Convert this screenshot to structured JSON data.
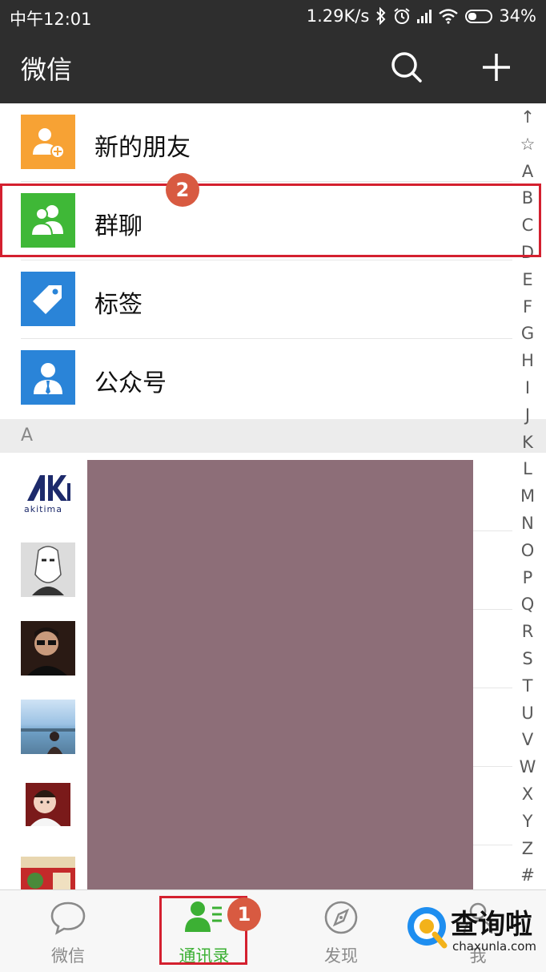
{
  "status_bar": {
    "time": "中午12:01",
    "net_speed": "1.29K/s",
    "battery": "34%",
    "icons": [
      "bluetooth-icon",
      "alarm-icon",
      "signal-icon",
      "wifi-icon",
      "battery-icon"
    ]
  },
  "header": {
    "title": "微信",
    "search_icon": "search-icon",
    "add_icon": "plus-icon"
  },
  "fixed_items": [
    {
      "label": "新的朋友",
      "icon": "new-friend-icon",
      "color": "#f7a234"
    },
    {
      "label": "群聊",
      "icon": "group-chat-icon",
      "color": "#3fb837"
    },
    {
      "label": "标签",
      "icon": "tag-icon",
      "color": "#2a84d8"
    },
    {
      "label": "公众号",
      "icon": "official-account-icon",
      "color": "#2a84d8"
    }
  ],
  "section_letter": "A",
  "contacts": [
    {
      "avatar": "akitima-logo",
      "avatar_text": "akitima"
    },
    {
      "avatar": "sketch-portrait-avatar"
    },
    {
      "avatar": "sunglasses-man-avatar"
    },
    {
      "avatar": "sea-girl-avatar"
    },
    {
      "avatar": "baby-avatar"
    },
    {
      "avatar": "red-poster-avatar"
    }
  ],
  "index_letters": [
    "↑",
    "☆",
    "A",
    "B",
    "C",
    "D",
    "E",
    "F",
    "G",
    "H",
    "I",
    "J",
    "K",
    "L",
    "M",
    "N",
    "O",
    "P",
    "Q",
    "R",
    "S",
    "T",
    "U",
    "V",
    "W",
    "X",
    "Y",
    "Z",
    "#"
  ],
  "tabs": [
    {
      "label": "微信",
      "icon": "chat-bubble-icon",
      "active": false
    },
    {
      "label": "通讯录",
      "icon": "contacts-icon",
      "active": true
    },
    {
      "label": "发现",
      "icon": "compass-icon",
      "active": false
    },
    {
      "label": "我",
      "icon": "me-icon",
      "active": false
    }
  ],
  "annotations": {
    "badge_1": "1",
    "badge_2": "2",
    "highlight_color": "#d4202f",
    "badge_color": "#d85a41"
  },
  "watermark": {
    "title": "查询啦",
    "subtitle": "chaxunla.com"
  },
  "colors": {
    "header_bg": "#2e2e2e",
    "active_tab": "#3cb034",
    "privacy_mask": "#8d6e78"
  }
}
